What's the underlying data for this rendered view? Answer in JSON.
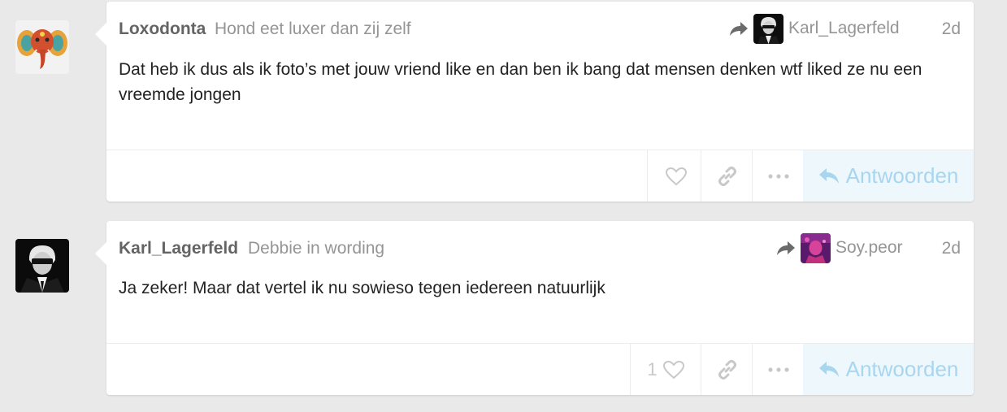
{
  "posts": [
    {
      "username": "Loxodonta",
      "user_title": "Hond eet luxer dan zij zelf",
      "reply_to": "Karl_Lagerfeld",
      "date": "2d",
      "body": "Dat heb ik dus als ik foto’s met jouw vriend like en dan ben ik bang dat mensen denken wtf liked ze nu een vreemde jongen",
      "like_count": "",
      "reply_label": "Antwoorden",
      "avatar_icon": "elephant-avatar",
      "reply_avatar_icon": "karl-lagerfeld-avatar"
    },
    {
      "username": "Karl_Lagerfeld",
      "user_title": "Debbie in wording",
      "reply_to": "Soy.peor",
      "date": "2d",
      "body": "Ja zeker! Maar dat vertel ik nu sowieso tegen iedereen natuurlijk",
      "like_count": "1",
      "reply_label": "Antwoorden",
      "avatar_icon": "karl-lagerfeld-avatar",
      "reply_avatar_icon": "soy-peor-avatar"
    }
  ],
  "colors": {
    "background": "#e9e9e9",
    "card": "#ffffff",
    "username": "#646464",
    "muted": "#959595",
    "icon": "#c8c8c8",
    "reply_bg": "#eef7fc",
    "reply_text": "#a8d6ef"
  }
}
